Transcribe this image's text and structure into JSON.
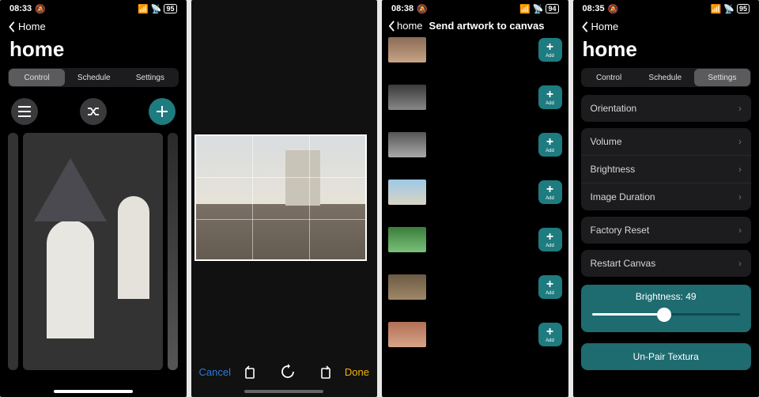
{
  "status": {
    "times": [
      "08:33",
      "",
      "08:38",
      "08:35"
    ],
    "silent_icon": "🔕",
    "battery": [
      "95",
      "",
      "94",
      "95"
    ]
  },
  "tabs": {
    "control": "Control",
    "schedule": "Schedule",
    "settings": "Settings"
  },
  "screen1": {
    "back": "Home",
    "title": "home"
  },
  "screen2": {
    "cancel": "Cancel",
    "done": "Done"
  },
  "screen3": {
    "back": "home",
    "title": "Send artwork to canvas",
    "add": "Add",
    "items": 7
  },
  "screen4": {
    "back": "Home",
    "title": "home",
    "rows": {
      "orientation": "Orientation",
      "volume": "Volume",
      "brightness": "Brightness",
      "image_duration": "Image Duration",
      "factory_reset": "Factory Reset",
      "restart": "Restart Canvas"
    },
    "bright_label": "Brightness: 49",
    "unpair": "Un-Pair Textura"
  }
}
